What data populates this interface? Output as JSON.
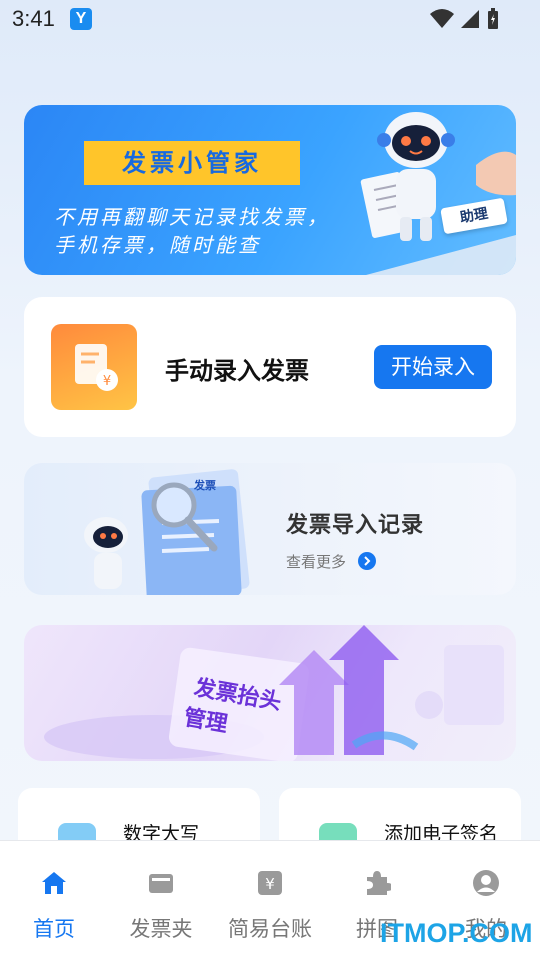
{
  "status_bar": {
    "time": "3:41",
    "app_icon_letter": "Y"
  },
  "banner": {
    "title": "发票小管家",
    "subtitle_line1": "不用再翻聊天记录找发票，",
    "subtitle_line2": "手机存票，随时能查",
    "helper_tag": "助理"
  },
  "manual_entry": {
    "label": "手动录入发票",
    "button": "开始录入"
  },
  "import_records": {
    "title": "发票导入记录",
    "more": "查看更多",
    "doc_tag": "发票"
  },
  "invoice_header": {
    "line1": "发票抬头",
    "line2": "管理"
  },
  "tools": [
    {
      "label": "数字大写",
      "icon": "number-icon",
      "color": "#4fb6f2"
    },
    {
      "label": "添加电子签名",
      "icon": "signature-icon",
      "color": "#3dd0a0"
    }
  ],
  "tab_bar": {
    "tabs": [
      {
        "label": "首页",
        "icon": "home-icon",
        "active": true
      },
      {
        "label": "发票夹",
        "icon": "wallet-icon",
        "active": false
      },
      {
        "label": "简易台账",
        "icon": "ledger-icon",
        "active": false
      },
      {
        "label": "拼图",
        "icon": "puzzle-icon",
        "active": false
      },
      {
        "label": "我的",
        "icon": "profile-icon",
        "active": false
      }
    ]
  },
  "watermark": "ITMOP.COM",
  "colors": {
    "accent": "#1677f0",
    "banner": "#2b86f5",
    "title_box": "#ffc52a",
    "header_purple": "#6b32d8"
  }
}
